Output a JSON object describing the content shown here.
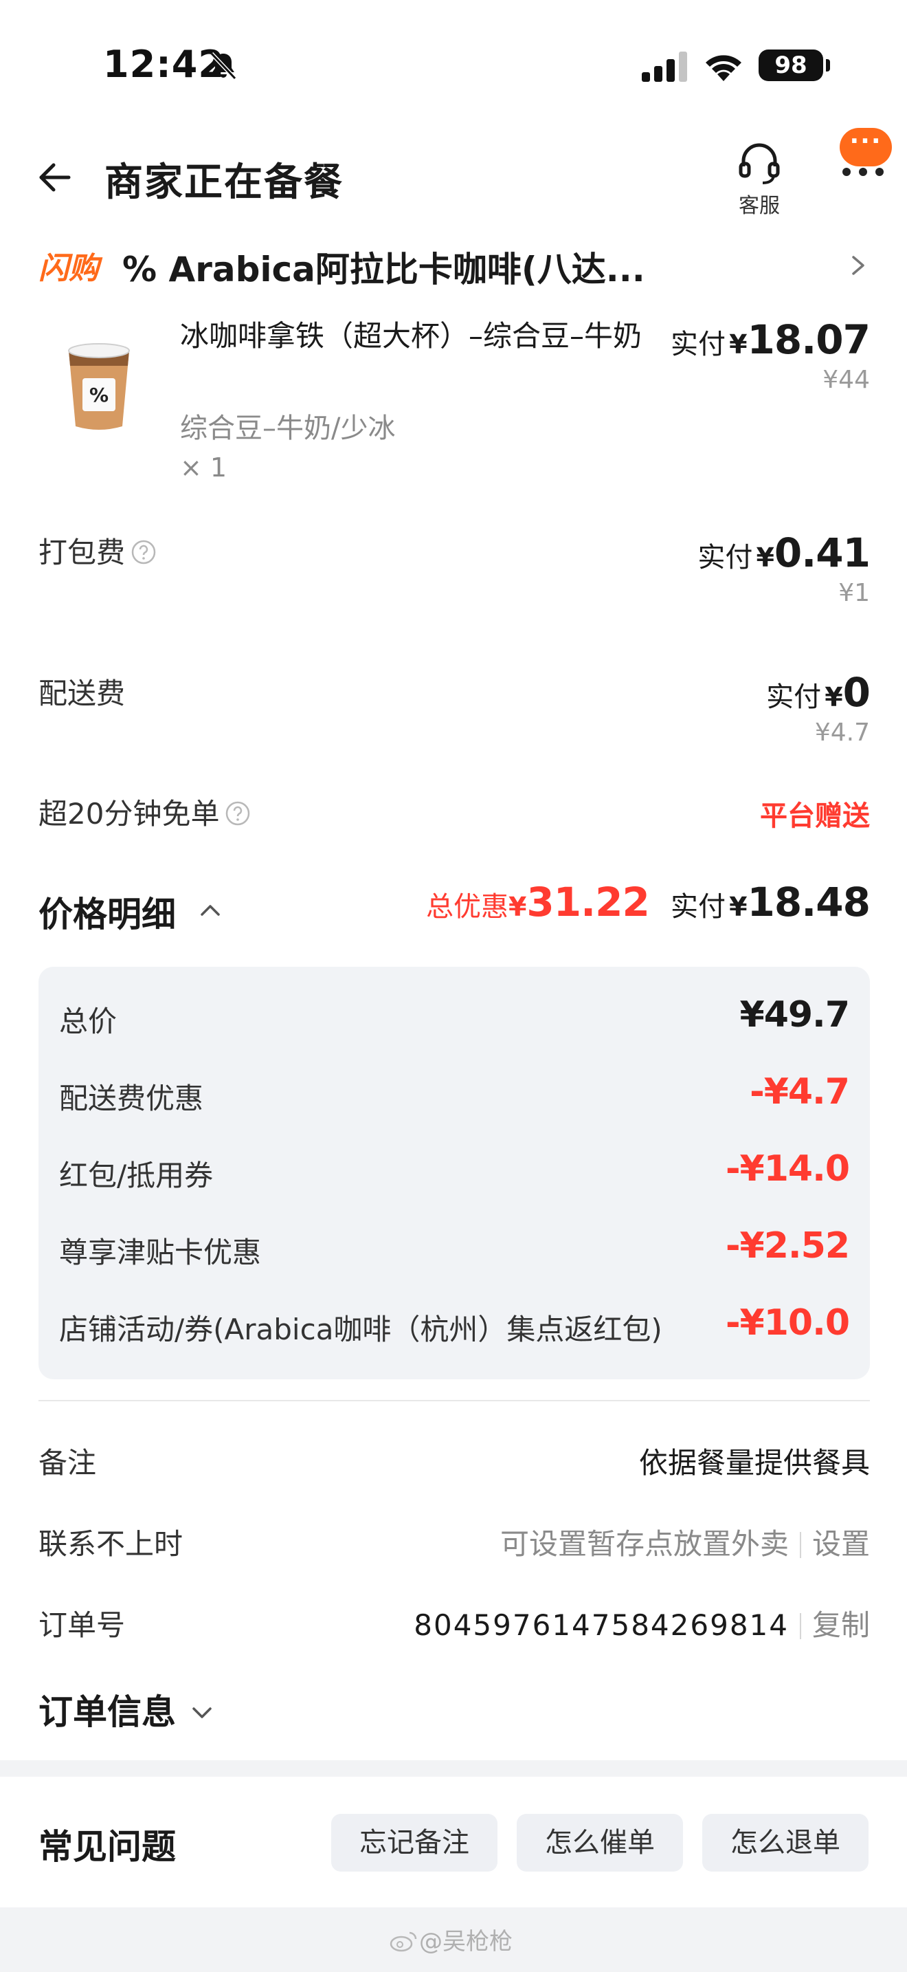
{
  "status_bar": {
    "time": "12:42",
    "battery": "98"
  },
  "header": {
    "title": "商家正在备餐",
    "service_label": "客服",
    "more_bubble": "···"
  },
  "store": {
    "flash_tag": "闪购",
    "name": "% Arabica阿拉比卡咖啡(八达..."
  },
  "product": {
    "name": "冰咖啡拿铁（超大杯）–综合豆–牛奶",
    "spec": "综合豆–牛奶/少冰",
    "qty": "× 1",
    "paid_label": "实付",
    "currency": "¥",
    "paid": "18.07",
    "original": "¥44"
  },
  "fees": [
    {
      "label": "打包费",
      "paid_label": "实付",
      "currency": "¥",
      "paid": "0.41",
      "original": "¥1"
    },
    {
      "label": "配送费",
      "paid_label": "实付",
      "currency": "¥",
      "paid": "0",
      "original": "¥4.7"
    }
  ],
  "free_order": {
    "label": "超20分钟免单",
    "tag": "平台赠送"
  },
  "price_details": {
    "title": "价格明细",
    "discount_label": "总优惠",
    "currency": "¥",
    "discount": "31.22",
    "paid_label": "实付",
    "paid": "18.48",
    "lines": [
      {
        "label": "总价",
        "amount": "¥49.7"
      },
      {
        "label": "配送费优惠",
        "amount": "-¥4.7"
      },
      {
        "label": "红包/抵用券",
        "amount": "-¥14.0"
      },
      {
        "label": "尊享津贴卡优惠",
        "amount": "-¥2.52"
      },
      {
        "label": "店铺活动/券(Arabica咖啡（杭州）集点返红包)",
        "amount": "-¥10.0"
      }
    ]
  },
  "info": {
    "note_label": "备注",
    "note_value": "依据餐量提供餐具",
    "contact_label": "联系不上时",
    "contact_value": "可设置暂存点放置外卖",
    "contact_action": "设置",
    "order_label": "订单号",
    "order_no": "8045976147584269814",
    "copy_action": "复制",
    "order_info_title": "订单信息"
  },
  "faq": {
    "title": "常见问题",
    "buttons": [
      "忘记备注",
      "怎么催单",
      "怎么退单"
    ]
  },
  "watermark": "@吴枪枪",
  "colors": {
    "accent": "#ff6a1a",
    "discount_red": "#ff3b30",
    "panel_bg": "#f1f3f6"
  }
}
